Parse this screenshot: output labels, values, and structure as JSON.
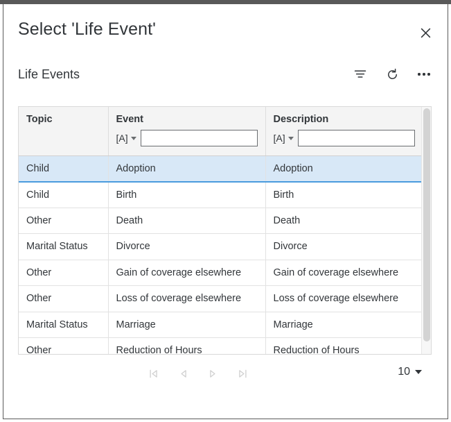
{
  "dialog": {
    "title": "Select 'Life Event'",
    "close_icon": "close-icon"
  },
  "toolbar": {
    "title": "Life Events",
    "icons": [
      {
        "name": "filter-icon",
        "label": "Filter"
      },
      {
        "name": "refresh-icon",
        "label": "Refresh"
      },
      {
        "name": "overflow-menu-icon",
        "label": "More"
      }
    ]
  },
  "table": {
    "columns": [
      {
        "key": "topic",
        "label": "Topic",
        "has_filter": false
      },
      {
        "key": "event",
        "label": "Event",
        "has_filter": true,
        "type_token": "[A]",
        "filter_value": "",
        "filter_placeholder": ""
      },
      {
        "key": "description",
        "label": "Description",
        "has_filter": true,
        "type_token": "[A]",
        "filter_value": "",
        "filter_placeholder": ""
      }
    ],
    "rows": [
      {
        "topic": "Child",
        "event": "Adoption",
        "description": "Adoption",
        "selected": true
      },
      {
        "topic": "Child",
        "event": "Birth",
        "description": "Birth",
        "selected": false
      },
      {
        "topic": "Other",
        "event": "Death",
        "description": "Death",
        "selected": false
      },
      {
        "topic": "Marital Status",
        "event": "Divorce",
        "description": "Divorce",
        "selected": false
      },
      {
        "topic": "Other",
        "event": "Gain of coverage elsewhere",
        "description": "Gain of coverage elsewhere",
        "selected": false
      },
      {
        "topic": "Other",
        "event": "Loss of coverage elsewhere",
        "description": "Loss of coverage elsewhere",
        "selected": false
      },
      {
        "topic": "Marital Status",
        "event": "Marriage",
        "description": "Marriage",
        "selected": false
      },
      {
        "topic": "Other",
        "event": "Reduction of Hours",
        "description": "Reduction of Hours",
        "selected": false
      }
    ]
  },
  "pagination": {
    "buttons": [
      {
        "name": "first-page-button",
        "icon": "first-page-icon",
        "disabled": true
      },
      {
        "name": "previous-page-button",
        "icon": "previous-page-icon",
        "disabled": true
      },
      {
        "name": "next-page-button",
        "icon": "next-page-icon",
        "disabled": true
      },
      {
        "name": "last-page-button",
        "icon": "last-page-icon",
        "disabled": true
      }
    ],
    "page_size": "10"
  },
  "colors": {
    "selected_row_bg": "#d8e8f7",
    "selected_row_border": "#4a9bde",
    "header_bg": "#f4f4f4",
    "text": "#32363a",
    "frame": "#5a5a5a"
  }
}
